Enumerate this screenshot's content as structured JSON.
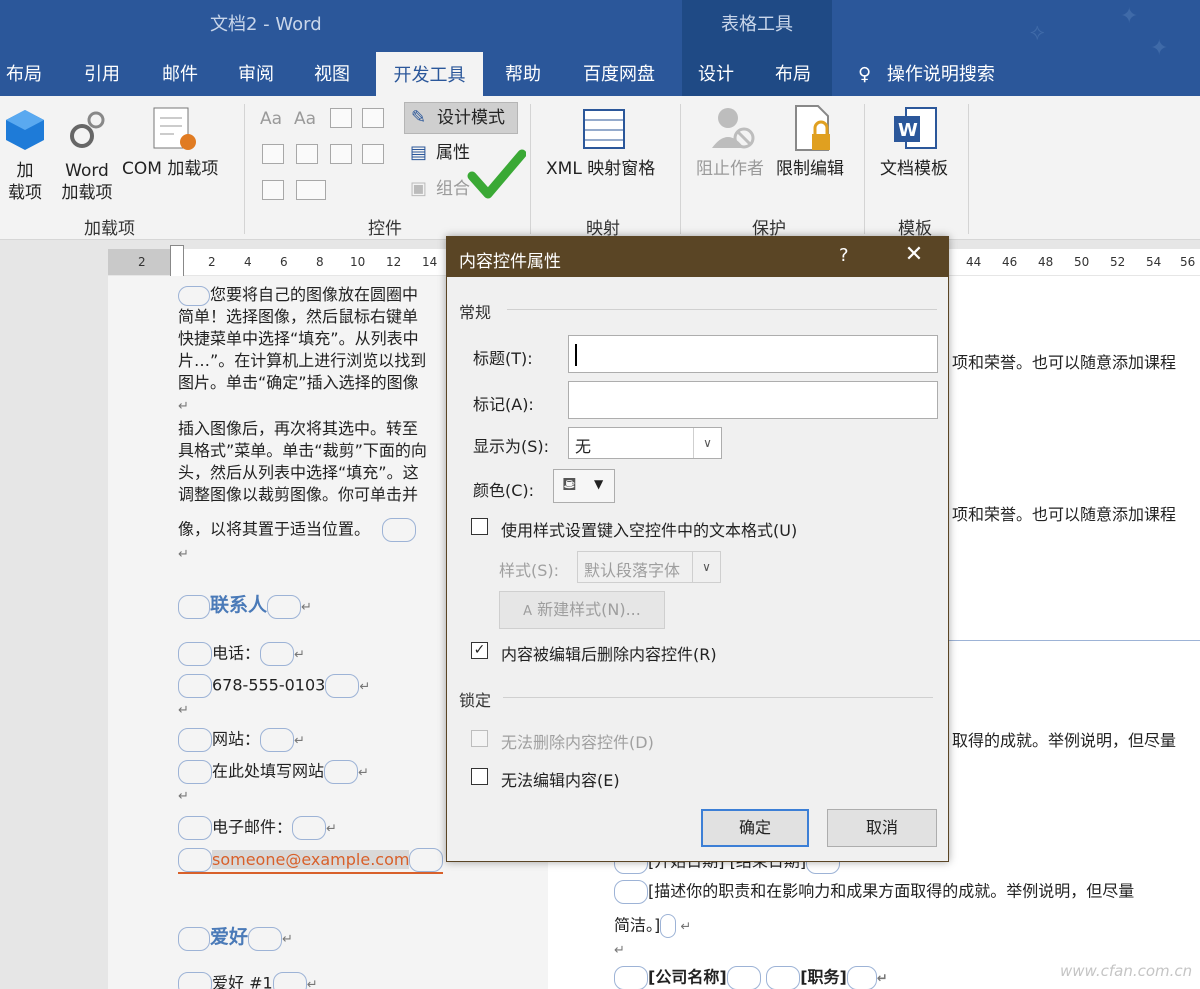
{
  "window": {
    "title": "文档2  -  Word",
    "context_tab_group": "表格工具"
  },
  "tabs": [
    "布局",
    "引用",
    "邮件",
    "审阅",
    "视图",
    "开发工具",
    "帮助",
    "百度网盘",
    "设计",
    "布局"
  ],
  "tell_me": "操作说明搜索",
  "ribbon": {
    "addins": {
      "btn1": "加\n载项",
      "btn2": "Word\n加载项",
      "btn3": "COM 加载项",
      "group": "加载项"
    },
    "controls": {
      "design_mode": "设计模式",
      "properties": "属性",
      "group_btn": "组合",
      "group": "控件"
    },
    "mapping": {
      "xml_pane": "XML 映射窗格",
      "group": "映射"
    },
    "protect": {
      "block_authors": "阻止作者",
      "restrict": "限制编辑",
      "group": "保护"
    },
    "templates": {
      "doc_template": "文档模板",
      "group": "模板"
    }
  },
  "ruler": {
    "numbers": [
      "2",
      "2",
      "4",
      "6",
      "8",
      "10",
      "12",
      "14",
      "44",
      "46",
      "48",
      "50",
      "52",
      "54",
      "56"
    ]
  },
  "doc_left": {
    "para1": [
      "您要将自己的图像放在圆圈中",
      "简单！选择图像，然后鼠标右键单",
      "快捷菜单中选择“填充”。从列表中",
      "片…”。在计算机上进行浏览以找到",
      "图片。单击“确定”插入选择的图像"
    ],
    "para2": [
      "插入图像后，再次将其选中。转至",
      "具格式”菜单。单击“裁剪”下面的向",
      "头，然后从列表中选择“填充”。这",
      "调整图像以裁剪图像。你可单击并",
      "像，以将其置于适当位置。"
    ],
    "contact_head": "联系人",
    "phone_label": "电话：",
    "phone": "678-555-0103",
    "website_label": "网站：",
    "website": "在此处填写网站",
    "email_label": "电子邮件：",
    "email": "someone@example.com",
    "hobby_head": "爱好",
    "hobby1": "爱好 #1"
  },
  "doc_right": {
    "line1": "项和荣誉。也可以随意添加课程",
    "line2": "项和荣誉。也可以随意添加课程",
    "line3": "取得的成就。举例说明，但尽量",
    "start_end": "[开始日期]    [结束日期]",
    "desc1": "[描述你的职责和在影响力和成果方面取得的成就。举例说明，但尽量",
    "desc2": "简洁。]",
    "company": "[公司名称]",
    "role": "[职务]"
  },
  "dialog": {
    "title": "内容控件属性",
    "help": "?",
    "close": "✕",
    "section_general": "常规",
    "title_label": "标题(T):",
    "title_value": "",
    "tag_label": "标记(A):",
    "tag_value": "",
    "showas_label": "显示为(S):",
    "showas_value": "无",
    "color_label": "颜色(C):",
    "use_style_label": "使用样式设置键入空控件中的文本格式(U)",
    "use_style_checked": false,
    "style_label": "样式(S):",
    "style_value": "默认段落字体",
    "new_style_btn": "新建样式(N)...",
    "remove_label": "内容被编辑后删除内容控件(R)",
    "remove_checked": true,
    "section_lock": "锁定",
    "cannot_delete_label": "无法删除内容控件(D)",
    "cannot_edit_label": "无法编辑内容(E)",
    "ok": "确定",
    "cancel": "取消"
  },
  "watermark": "www.cfan.com.cn",
  "colors": {
    "title_bar": "#2b579a",
    "dialog_title": "#5a4525",
    "checkmark_green": "#3aa935",
    "accent": "#4a7ab8"
  }
}
